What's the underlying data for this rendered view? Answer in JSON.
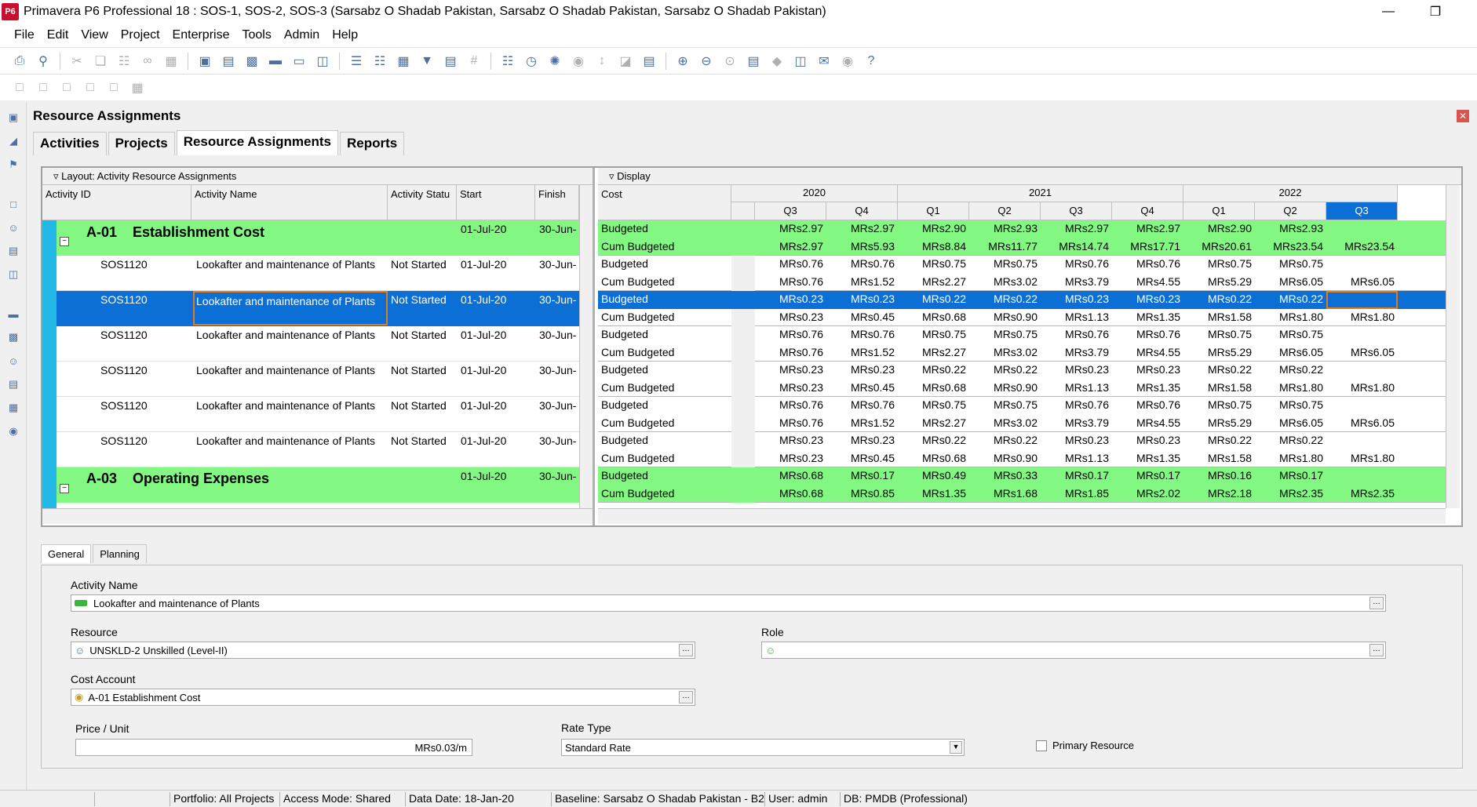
{
  "window": {
    "title": "Primavera P6 Professional 18 : SOS-1, SOS-2, SOS-3 (Sarsabz O Shadab Pakistan, Sarsabz O Shadab Pakistan, Sarsabz O Shadab Pakistan)",
    "logo": "P6"
  },
  "menu": [
    "File",
    "Edit",
    "View",
    "Project",
    "Enterprise",
    "Tools",
    "Admin",
    "Help"
  ],
  "panel": {
    "title": "Resource Assignments"
  },
  "tabs": [
    "Activities",
    "Projects",
    "Resource Assignments",
    "Reports"
  ],
  "left": {
    "layout_label": "Layout: Activity Resource Assignments",
    "columns": [
      "Activity ID",
      "Activity Name",
      "Activity Statu",
      "Start",
      "Finish"
    ]
  },
  "groups": [
    {
      "code": "A-01",
      "name": "Establishment Cost",
      "start": "01-Jul-20",
      "finish": "30-Jun-"
    },
    {
      "code": "A-03",
      "name": "Operating Expenses",
      "start": "01-Jul-20",
      "finish": "30-Jun-"
    }
  ],
  "rows": [
    {
      "id": "SOS1120",
      "name": "Lookafter and maintenance of Plants",
      "status": "Not Started",
      "start": "01-Jul-20",
      "finish": "30-Jun-"
    },
    {
      "id": "SOS1120",
      "name": "Lookafter and maintenance of Plants",
      "status": "Not Started",
      "start": "01-Jul-20",
      "finish": "30-Jun-"
    },
    {
      "id": "SOS1120",
      "name": "Lookafter and maintenance of Plants",
      "status": "Not Started",
      "start": "01-Jul-20",
      "finish": "30-Jun-"
    },
    {
      "id": "SOS1120",
      "name": "Lookafter and maintenance of Plants",
      "status": "Not Started",
      "start": "01-Jul-20",
      "finish": "30-Jun-"
    },
    {
      "id": "SOS1120",
      "name": "Lookafter and maintenance of Plants",
      "status": "Not Started",
      "start": "01-Jul-20",
      "finish": "30-Jun-"
    },
    {
      "id": "SOS1120",
      "name": "Lookafter and maintenance of Plants",
      "status": "Not Started",
      "start": "01-Jul-20",
      "finish": "30-Jun-"
    }
  ],
  "right": {
    "display_label": "Display",
    "cost_label": "Cost",
    "years": [
      "2020",
      "2021",
      "2022"
    ],
    "quarters": [
      "Q3",
      "Q4",
      "Q1",
      "Q2",
      "Q3",
      "Q4",
      "Q1",
      "Q2",
      "Q3"
    ]
  },
  "cost_rows": [
    {
      "label": "Budgeted",
      "vals": [
        "MRs2.97",
        "MRs2.97",
        "MRs2.90",
        "MRs2.93",
        "MRs2.97",
        "MRs2.97",
        "MRs2.90",
        "MRs2.93",
        ""
      ]
    },
    {
      "label": "Cum Budgeted",
      "vals": [
        "MRs2.97",
        "MRs5.93",
        "MRs8.84",
        "MRs11.77",
        "MRs14.74",
        "MRs17.71",
        "MRs20.61",
        "MRs23.54",
        "MRs23.54"
      ]
    },
    {
      "label": "Budgeted",
      "vals": [
        "MRs0.76",
        "MRs0.76",
        "MRs0.75",
        "MRs0.75",
        "MRs0.76",
        "MRs0.76",
        "MRs0.75",
        "MRs0.75",
        ""
      ]
    },
    {
      "label": "Cum Budgeted",
      "vals": [
        "MRs0.76",
        "MRs1.52",
        "MRs2.27",
        "MRs3.02",
        "MRs3.79",
        "MRs4.55",
        "MRs5.29",
        "MRs6.05",
        "MRs6.05"
      ]
    },
    {
      "label": "Budgeted",
      "vals": [
        "MRs0.23",
        "MRs0.23",
        "MRs0.22",
        "MRs0.22",
        "MRs0.23",
        "MRs0.23",
        "MRs0.22",
        "MRs0.22",
        ""
      ]
    },
    {
      "label": "Cum Budgeted",
      "vals": [
        "MRs0.23",
        "MRs0.45",
        "MRs0.68",
        "MRs0.90",
        "MRs1.13",
        "MRs1.35",
        "MRs1.58",
        "MRs1.80",
        "MRs1.80"
      ]
    },
    {
      "label": "Budgeted",
      "vals": [
        "MRs0.76",
        "MRs0.76",
        "MRs0.75",
        "MRs0.75",
        "MRs0.76",
        "MRs0.76",
        "MRs0.75",
        "MRs0.75",
        ""
      ]
    },
    {
      "label": "Cum Budgeted",
      "vals": [
        "MRs0.76",
        "MRs1.52",
        "MRs2.27",
        "MRs3.02",
        "MRs3.79",
        "MRs4.55",
        "MRs5.29",
        "MRs6.05",
        "MRs6.05"
      ]
    },
    {
      "label": "Budgeted",
      "vals": [
        "MRs0.23",
        "MRs0.23",
        "MRs0.22",
        "MRs0.22",
        "MRs0.23",
        "MRs0.23",
        "MRs0.22",
        "MRs0.22",
        ""
      ]
    },
    {
      "label": "Cum Budgeted",
      "vals": [
        "MRs0.23",
        "MRs0.45",
        "MRs0.68",
        "MRs0.90",
        "MRs1.13",
        "MRs1.35",
        "MRs1.58",
        "MRs1.80",
        "MRs1.80"
      ]
    },
    {
      "label": "Budgeted",
      "vals": [
        "MRs0.76",
        "MRs0.76",
        "MRs0.75",
        "MRs0.75",
        "MRs0.76",
        "MRs0.76",
        "MRs0.75",
        "MRs0.75",
        ""
      ]
    },
    {
      "label": "Cum Budgeted",
      "vals": [
        "MRs0.76",
        "MRs1.52",
        "MRs2.27",
        "MRs3.02",
        "MRs3.79",
        "MRs4.55",
        "MRs5.29",
        "MRs6.05",
        "MRs6.05"
      ]
    },
    {
      "label": "Budgeted",
      "vals": [
        "MRs0.23",
        "MRs0.23",
        "MRs0.22",
        "MRs0.22",
        "MRs0.23",
        "MRs0.23",
        "MRs0.22",
        "MRs0.22",
        ""
      ]
    },
    {
      "label": "Cum Budgeted",
      "vals": [
        "MRs0.23",
        "MRs0.45",
        "MRs0.68",
        "MRs0.90",
        "MRs1.13",
        "MRs1.35",
        "MRs1.58",
        "MRs1.80",
        "MRs1.80"
      ]
    },
    {
      "label": "Budgeted",
      "vals": [
        "MRs0.68",
        "MRs0.17",
        "MRs0.49",
        "MRs0.33",
        "MRs0.17",
        "MRs0.17",
        "MRs0.16",
        "MRs0.17",
        ""
      ]
    },
    {
      "label": "Cum Budgeted",
      "vals": [
        "MRs0.68",
        "MRs0.85",
        "MRs1.35",
        "MRs1.68",
        "MRs1.85",
        "MRs2.02",
        "MRs2.18",
        "MRs2.35",
        "MRs2.35"
      ]
    }
  ],
  "detail": {
    "tabs": [
      "General",
      "Planning"
    ],
    "activity_name_label": "Activity Name",
    "activity_name": "Lookafter and maintenance of Plants",
    "resource_label": "Resource",
    "resource": "UNSKLD-2  Unskilled (Level-II)",
    "role_label": "Role",
    "role": "",
    "cost_account_label": "Cost Account",
    "cost_account": "A-01  Establishment Cost",
    "price_label": "Price / Unit",
    "price": "MRs0.03/m",
    "rate_type_label": "Rate Type",
    "rate_type": "Standard Rate",
    "primary_label": "Primary Resource"
  },
  "status": [
    "Portfolio: All Projects",
    "Access Mode: Shared",
    "Data Date: 18-Jan-20",
    "Baseline: Sarsabz O Shadab Pakistan - B2",
    "User: admin",
    "DB: PMDB (Professional)"
  ],
  "colors": {
    "group_green": "#82f882",
    "selection": "#0c6fd6",
    "highlight_header": "#0c6fd6"
  }
}
